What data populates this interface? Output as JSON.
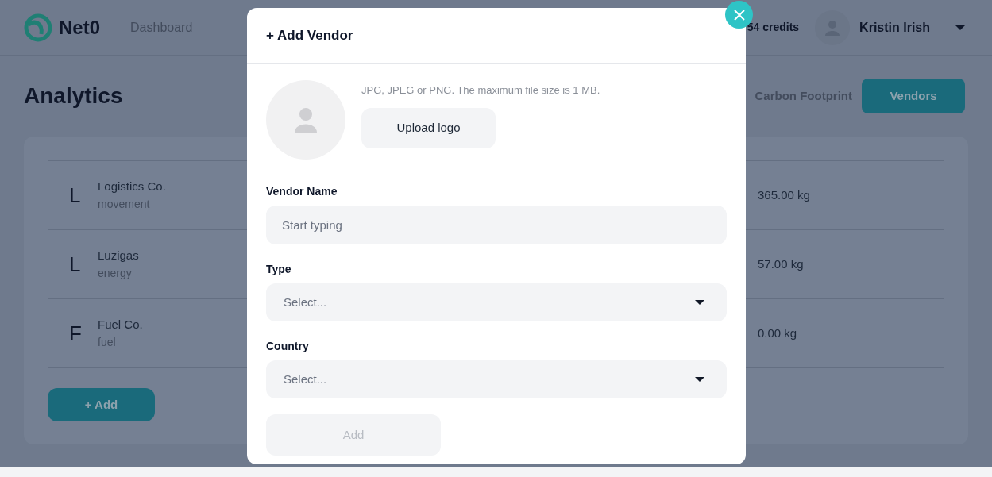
{
  "header": {
    "brand": "Net0",
    "nav": [
      {
        "label": "Dashboard",
        "selected": false
      }
    ],
    "credits": "54 credits",
    "user": "Kristin Irish"
  },
  "page": {
    "title": "Analytics",
    "tabs": [
      {
        "label": "Carbon Footprint",
        "selected": false
      },
      {
        "label": "Vendors",
        "selected": true
      }
    ]
  },
  "vendors": [
    {
      "initial": "L",
      "name": "Logistics Co.",
      "type": "movement",
      "emissions": "365.00 kg"
    },
    {
      "initial": "L",
      "name": "Luzigas",
      "type": "energy",
      "emissions": "57.00 kg"
    },
    {
      "initial": "F",
      "name": "Fuel Co.",
      "type": "fuel",
      "emissions": "0.00 kg"
    }
  ],
  "add_button": "+ Add",
  "modal": {
    "title": "+ Add Vendor",
    "logo_hint": "JPG, JPEG or PNG. The maximum file size is 1 MB.",
    "upload_button": "Upload logo",
    "fields": [
      {
        "kind": "text",
        "label": "Vendor Name",
        "placeholder": "Start typing"
      },
      {
        "kind": "select",
        "label": "Type",
        "placeholder": "Select..."
      },
      {
        "kind": "select",
        "label": "Country",
        "placeholder": "Select..."
      }
    ],
    "submit": {
      "label": "Add",
      "disabled": true
    }
  }
}
